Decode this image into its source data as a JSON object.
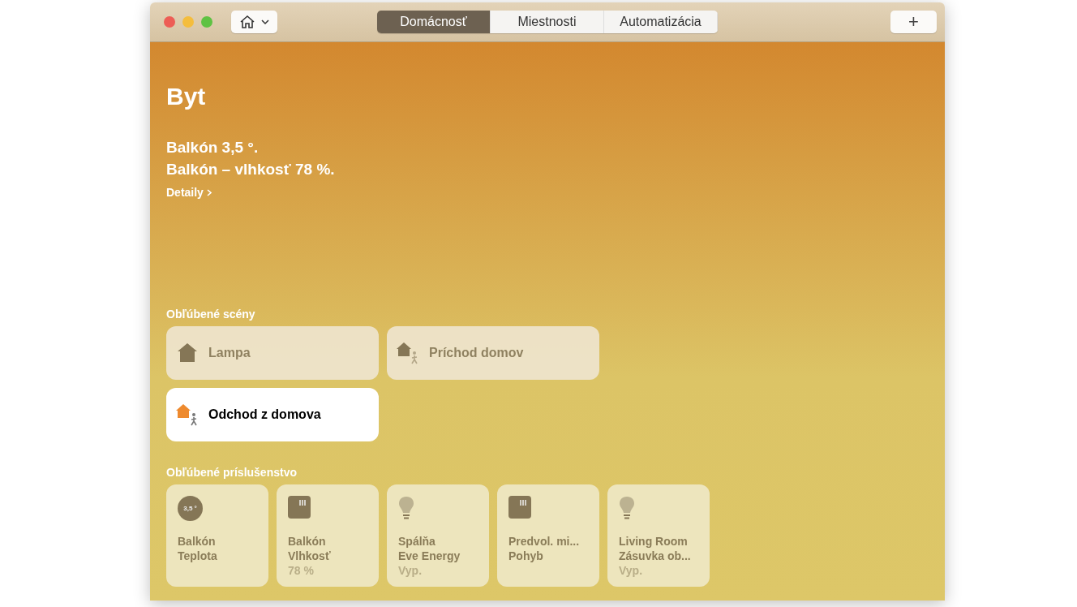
{
  "toolbar": {
    "tabs": [
      {
        "label": "Domácnosť",
        "selected": true
      },
      {
        "label": "Miestnosti",
        "selected": false
      },
      {
        "label": "Automatizácia",
        "selected": false
      }
    ],
    "add_button": "+"
  },
  "home": {
    "title": "Byt",
    "status_lines": [
      "Balkón 3,5 °.",
      "Balkón – vlhkosť 78 %."
    ],
    "details_link": "Detaily"
  },
  "scenes": {
    "heading": "Obľúbené scény",
    "items": [
      {
        "kind": "home",
        "label": "Lampa",
        "active": false
      },
      {
        "kind": "arrive",
        "label": "Príchod domov",
        "active": false
      },
      {
        "kind": "leave",
        "label": "Odchod z domova",
        "active": true
      }
    ]
  },
  "accessories": {
    "heading": "Obľúbené príslušenstvo",
    "items": [
      {
        "kind": "temperature",
        "icon_text": "3,5 °",
        "name": "Balkón",
        "type": "Teplota"
      },
      {
        "kind": "sensor",
        "name": "Balkón",
        "type": "Vlhkosť",
        "status": "78 %"
      },
      {
        "kind": "bulb",
        "name": "Spálňa",
        "type": "Eve Energy",
        "status": "Vyp."
      },
      {
        "kind": "sensor",
        "name": "Predvol. mi...",
        "type": "Pohyb"
      },
      {
        "kind": "bulb",
        "name": "Living Room",
        "type": "Zásuvka ob...",
        "status": "Vyp."
      }
    ]
  }
}
